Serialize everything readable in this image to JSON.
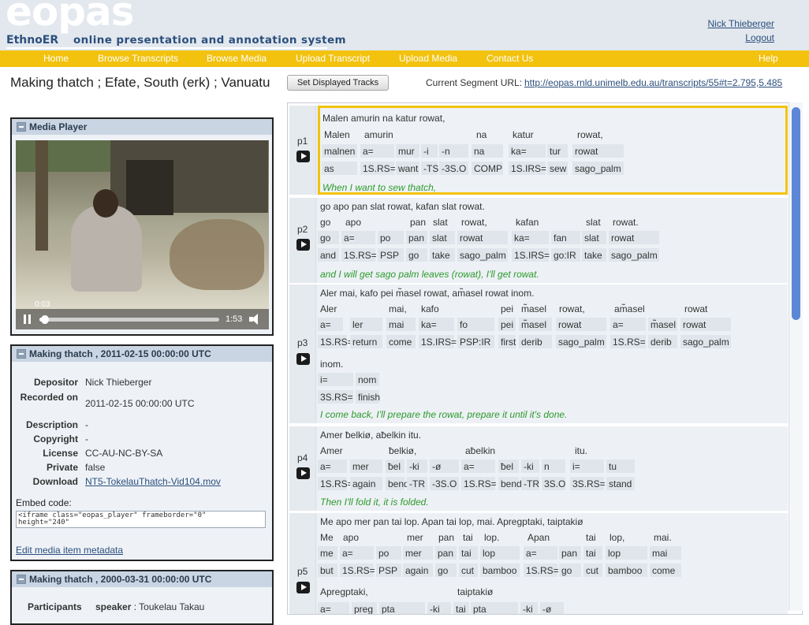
{
  "header": {
    "logo": "eopas",
    "subtitle": "EthnoER",
    "tagline": "online presentation and annotation system",
    "user_name": "Nick Thieberger",
    "logout": "Logout"
  },
  "nav": {
    "items": [
      "Home",
      "Browse Transcripts",
      "Browse Media",
      "Upload Transcript",
      "Upload Media",
      "Contact Us",
      "Help"
    ]
  },
  "page": {
    "title": "Making thatch ; Efate, South (erk) ; Vanuatu"
  },
  "toolbar": {
    "set_tracks": "Set Displayed Tracks",
    "segment_url_label": "Current Segment URL:",
    "segment_url": "http://eopas.rnld.unimelb.edu.au/transcripts/55#t=2.795,5.485"
  },
  "media_player": {
    "title": "Media Player",
    "current_time": "0:03",
    "total_time": "1:53",
    "progress": 0.03
  },
  "metadata": {
    "title": "Making thatch , 2011-02-15 00:00:00 UTC",
    "fields": [
      {
        "label": "Depositor",
        "value": "Nick Thieberger"
      },
      {
        "label": "Recorded on",
        "value": "2011-02-15 00:00:00 UTC"
      },
      {
        "label": "Description",
        "value": "-"
      },
      {
        "label": "Copyright",
        "value": "-"
      },
      {
        "label": "License",
        "value": "CC-AU-NC-BY-SA"
      },
      {
        "label": "Private",
        "value": "false"
      },
      {
        "label": "Download",
        "value": "NT5-TokelauThatch-Vid104.mov"
      }
    ],
    "embed_label": "Embed code:",
    "embed_code": "<iframe class=\"eopas_player\" frameborder=\"0\"\nheight=\"240\"",
    "edit_link": "Edit media item metadata"
  },
  "metadata2": {
    "title": "Making thatch , 2000-03-31 00:00:00 UTC",
    "participants_label": "Participants",
    "participants_role": "speaker",
    "participants_value": ": Toukelau Takau"
  },
  "transcript": {
    "phrases": [
      {
        "id": "p1",
        "text": "Malen amurin na katur rowat,",
        "words": [
          "Malen",
          "amurin",
          "na",
          "katur",
          "rowat,"
        ],
        "morphs": [
          "malnen",
          "a=",
          "mur",
          "-i",
          "-n",
          "na",
          "ka=",
          "tur",
          "rowat"
        ],
        "glosses": [
          "as",
          "1S.RS=",
          "want",
          "-TS",
          "-3S.O",
          "COMP",
          "1S.IRS=",
          "sew",
          "sago_palm"
        ],
        "translation": "When I want to sew thatch,"
      },
      {
        "id": "p2",
        "text": "go apo pan slat rowat, kafan slat rowat.",
        "words": [
          "go",
          "apo",
          "pan",
          "slat",
          "rowat,",
          "kafan",
          "slat",
          "rowat."
        ],
        "morphs": [
          "go",
          "a=",
          "po",
          "pan",
          "slat",
          "rowat",
          "ka=",
          "fan",
          "slat",
          "rowat"
        ],
        "glosses": [
          "and",
          "1S.RS=",
          "PSP",
          "go",
          "take",
          "sago_palm",
          "1S.IRS=",
          "go:IR",
          "take",
          "sago_palm"
        ],
        "translation": "and I will get sago palm leaves (rowat), I'll get rowat."
      },
      {
        "id": "p3",
        "text": "Aler mai, kafo pei m̃asel rowat, am̃asel rowat inom.",
        "words": [
          "Aler",
          "mai,",
          "kafo",
          "pei",
          "m̃asel",
          "rowat,",
          "am̃asel",
          "rowat"
        ],
        "morphs": [
          "a=",
          "ler",
          "mai",
          "ka=",
          "fo",
          "pei",
          "m̃asel",
          "rowat",
          "a=",
          "m̃asel",
          "rowat"
        ],
        "glosses": [
          "1S.RS=",
          "return",
          "come",
          "1S.IRS=",
          "PSP:IR",
          "first",
          "derib",
          "sago_palm",
          "1S.RS=",
          "derib",
          "sago_palm"
        ],
        "words2": [
          "inom."
        ],
        "morphs2": [
          "i=",
          "nom"
        ],
        "glosses2": [
          "3S.RS=",
          "finish"
        ],
        "translation": "I come back, I'll prepare the rowat, prepare it until it's done."
      },
      {
        "id": "p4",
        "text": "Amer ƀelkiø, aƀelkin itu.",
        "words": [
          "Amer",
          "ƀelkiø,",
          "aƀelkin",
          "itu."
        ],
        "morphs": [
          "a=",
          "mer",
          "ƀel",
          "-ki",
          "-ø",
          "a=",
          "ƀel",
          "-ki",
          "n",
          "i=",
          "tu"
        ],
        "glosses": [
          "1S.RS=",
          "again",
          "bend",
          "-TR",
          "-3S.O",
          "1S.RS=",
          "bend",
          "-TR",
          "3S.O",
          "3S.RS=",
          "stand"
        ],
        "translation": "Then I'll fold it, it is folded."
      },
      {
        "id": "p5",
        "text": "Me apo mer pan tai lop. Apan tai lop, mai. Apregptaki, taiptakiø",
        "words": [
          "Me",
          "apo",
          "mer",
          "pan",
          "tai",
          "lop.",
          "Apan",
          "tai",
          "lop,",
          "mai."
        ],
        "morphs": [
          "me",
          "a=",
          "po",
          "mer",
          "pan",
          "tai",
          "lop",
          "a=",
          "pan",
          "tai",
          "lop",
          "mai"
        ],
        "glosses": [
          "but",
          "1S.RS=",
          "PSP",
          "again",
          "go",
          "cut",
          "bamboo",
          "1S.RS=",
          "go",
          "cut",
          "bamboo",
          "come"
        ],
        "words2": [
          "Apregptaki,",
          "taiptakiø"
        ],
        "morphs2": [
          "a=",
          "preg",
          "pta",
          "-ki",
          "tai",
          "pta",
          "-ki",
          "-ø"
        ]
      }
    ]
  }
}
